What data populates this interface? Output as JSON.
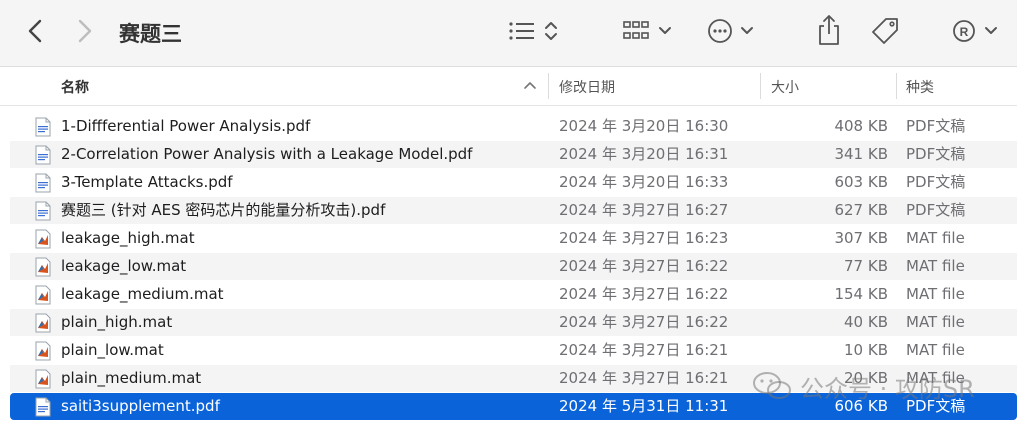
{
  "window": {
    "title": "赛题三",
    "toolbar": {
      "back_icon": "chevron-left-icon",
      "forward_icon": "chevron-right-icon",
      "view_icon": "list-view-icon",
      "group_icon": "grid-view-icon",
      "more_icon": "ellipsis-circle-icon",
      "share_icon": "share-icon",
      "tag_icon": "tag-icon",
      "profile_icon": "registered-icon"
    }
  },
  "columns": {
    "name": "名称",
    "date": "修改日期",
    "size": "大小",
    "kind": "种类"
  },
  "files": [
    {
      "name": "1-Diffferential Power Analysis.pdf",
      "date": "2024 年 3月20日 16:30",
      "size": "408 KB",
      "kind": "PDF文稿",
      "icon": "pdf-file-icon"
    },
    {
      "name": "2-Correlation Power Analysis  with a Leakage Model.pdf",
      "date": "2024 年 3月20日 16:31",
      "size": "341 KB",
      "kind": "PDF文稿",
      "icon": "pdf-file-icon"
    },
    {
      "name": "3-Template Attacks.pdf",
      "date": "2024 年 3月20日 16:33",
      "size": "603 KB",
      "kind": "PDF文稿",
      "icon": "pdf-file-icon"
    },
    {
      "name": "赛题三 (针对 AES 密码芯片的能量分析攻击).pdf",
      "date": "2024 年 3月27日 16:27",
      "size": "627 KB",
      "kind": "PDF文稿",
      "icon": "pdf-file-icon"
    },
    {
      "name": "leakage_high.mat",
      "date": "2024 年 3月27日 16:23",
      "size": "307 KB",
      "kind": "MAT file",
      "icon": "matlab-file-icon"
    },
    {
      "name": "leakage_low.mat",
      "date": "2024 年 3月27日 16:22",
      "size": "77 KB",
      "kind": "MAT file",
      "icon": "matlab-file-icon"
    },
    {
      "name": "leakage_medium.mat",
      "date": "2024 年 3月27日 16:22",
      "size": "154 KB",
      "kind": "MAT file",
      "icon": "matlab-file-icon"
    },
    {
      "name": "plain_high.mat",
      "date": "2024 年 3月27日 16:22",
      "size": "40 KB",
      "kind": "MAT file",
      "icon": "matlab-file-icon"
    },
    {
      "name": "plain_low.mat",
      "date": "2024 年 3月27日 16:21",
      "size": "10 KB",
      "kind": "MAT file",
      "icon": "matlab-file-icon"
    },
    {
      "name": "plain_medium.mat",
      "date": "2024 年 3月27日 16:21",
      "size": "20 KB",
      "kind": "MAT file",
      "icon": "matlab-file-icon"
    },
    {
      "name": "saiti3supplement.pdf",
      "date": "2024 年 5月31日 11:31",
      "size": "606 KB",
      "kind": "PDF文稿",
      "icon": "pdf-file-icon",
      "selected": true
    }
  ],
  "watermark": {
    "text": "公众号 · 攻防SR",
    "icon": "wechat-icon"
  }
}
